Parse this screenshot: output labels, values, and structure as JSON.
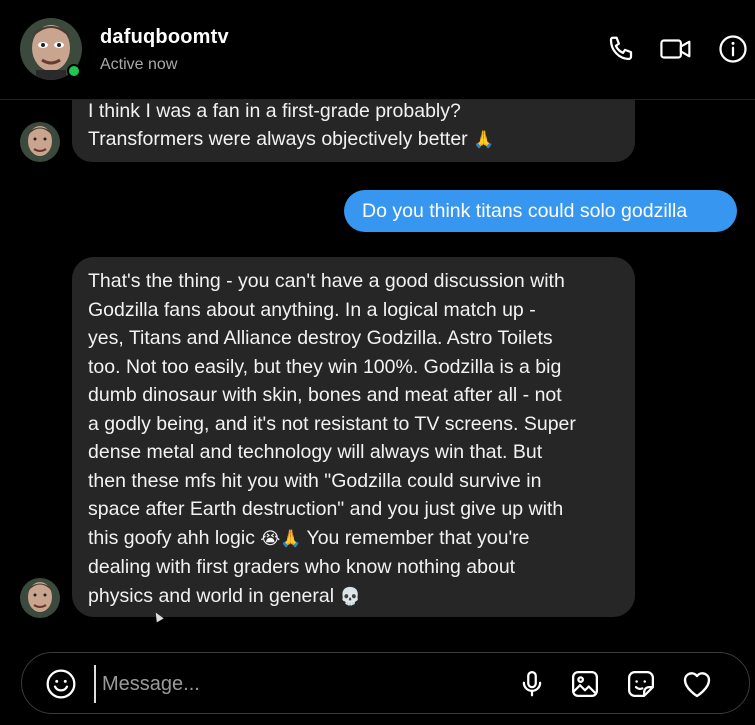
{
  "header": {
    "username": "dafuqboomtv",
    "status": "Active now"
  },
  "messages": [
    {
      "direction": "incoming",
      "lines": [
        "I think I was a fan in a first-grade probably?",
        "Transformers were always objectively better"
      ],
      "trailing_emoji": "🙏"
    },
    {
      "direction": "outgoing",
      "text": "Do you think titans could solo godzilla"
    },
    {
      "direction": "incoming",
      "lines": [
        "That's the thing - you can't have a good discussion with",
        "Godzilla fans about anything. In a logical match up -",
        "yes, Titans and Alliance destroy Godzilla. Astro Toilets",
        "too. Not too easily, but they win 100%. Godzilla is a big",
        "dumb dinosaur with skin, bones and meat after all - not",
        "a godly being, and it's not resistant to TV screens. Super",
        "dense metal and technology will always win that. But",
        "then these mfs hit you with \"Godzilla could survive in",
        "space after Earth destruction\" and you just give up with",
        "this goofy ahh logic",
        "dealing with first graders who know nothing about",
        "physics and world in general"
      ],
      "inline_emoji": "😭🙏",
      "line10_suffix": " You remember that you're",
      "trailing_emoji": "💀"
    }
  ],
  "composer": {
    "placeholder": "Message..."
  },
  "colors": {
    "background": "#000000",
    "incoming_bubble": "#262626",
    "outgoing_bubble": "#3797f0",
    "online": "#1fc84b"
  },
  "icons": [
    "phone-icon",
    "video-icon",
    "info-icon",
    "emoji-icon",
    "microphone-icon",
    "image-icon",
    "sticker-icon",
    "heart-icon"
  ]
}
